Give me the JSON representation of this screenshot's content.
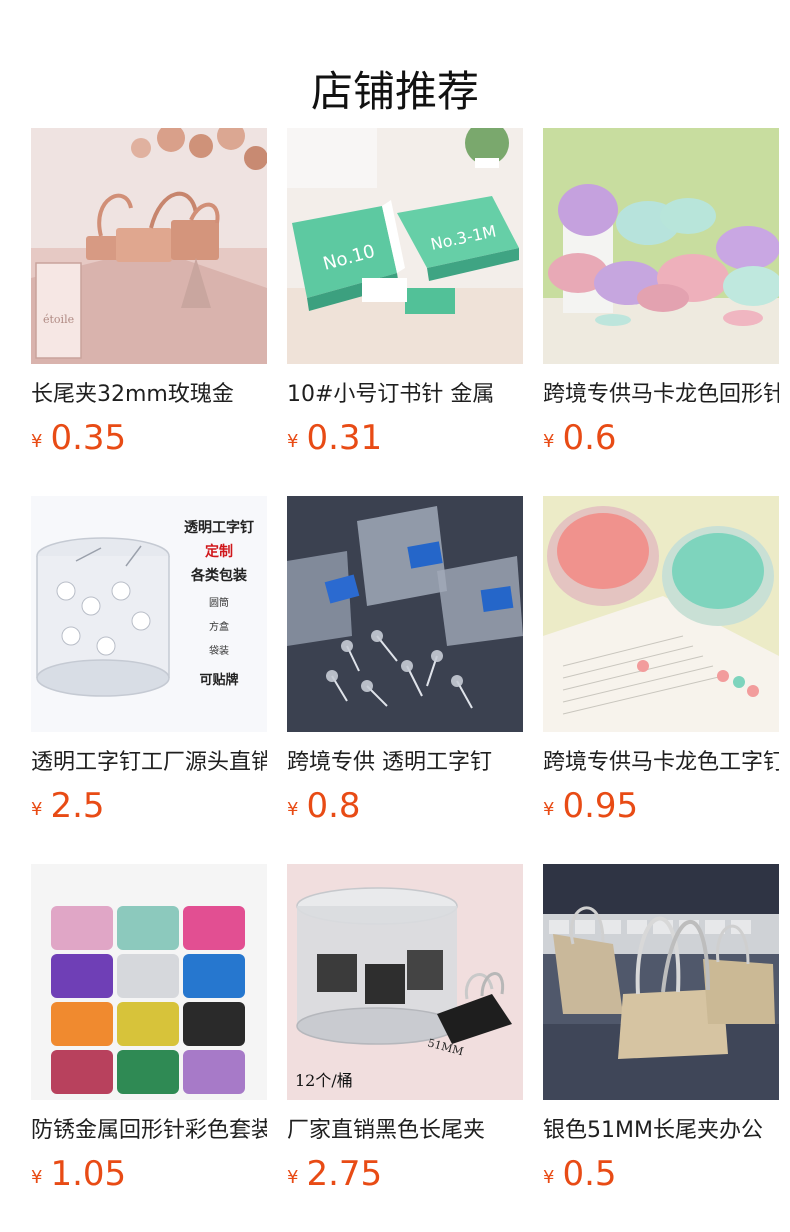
{
  "page": {
    "title": "店铺推荐"
  },
  "currency": "¥",
  "products": [
    {
      "name": "长尾夹32mm玫瑰金",
      "price": "0.35",
      "image": "rose-gold-binder-clips-photo"
    },
    {
      "name": "10#小号订书针 金属",
      "price": "0.31",
      "image": "staples-boxes-photo"
    },
    {
      "name": "跨境专供马卡龙色回形针",
      "price": "0.6",
      "image": "macaron-paper-clips-photo"
    },
    {
      "name": "透明工字钉工厂源头直销",
      "price": "2.5",
      "image": "clear-pushpins-jar-photo",
      "image_text": {
        "title": "透明工字钉",
        "custom": "定制",
        "pack": "各类包装",
        "opt1": "圆筒",
        "opt2": "方盒",
        "opt3": "袋装",
        "opt4": "可贴牌"
      }
    },
    {
      "name": "跨境专供 透明工字钉",
      "price": "0.8",
      "image": "clear-pushpins-boxes-photo"
    },
    {
      "name": "跨境专供马卡龙色工字钉",
      "price": "0.95",
      "image": "macaron-pushpins-photo"
    },
    {
      "name": "防锈金属回形针彩色套装",
      "price": "1.05",
      "image": "colorful-paper-clips-jars-photo"
    },
    {
      "name": "厂家直销黑色长尾夹",
      "price": "2.75",
      "image": "black-binder-clips-tub-photo",
      "image_text": {
        "count": "12个/桶",
        "size": "51MM"
      }
    },
    {
      "name": "银色51MM长尾夹办公",
      "price": "0.5",
      "image": "silver-binder-clips-photo"
    }
  ],
  "colors": {
    "price": "#e84b15",
    "title": "#111111",
    "name": "#1f1f1f"
  }
}
